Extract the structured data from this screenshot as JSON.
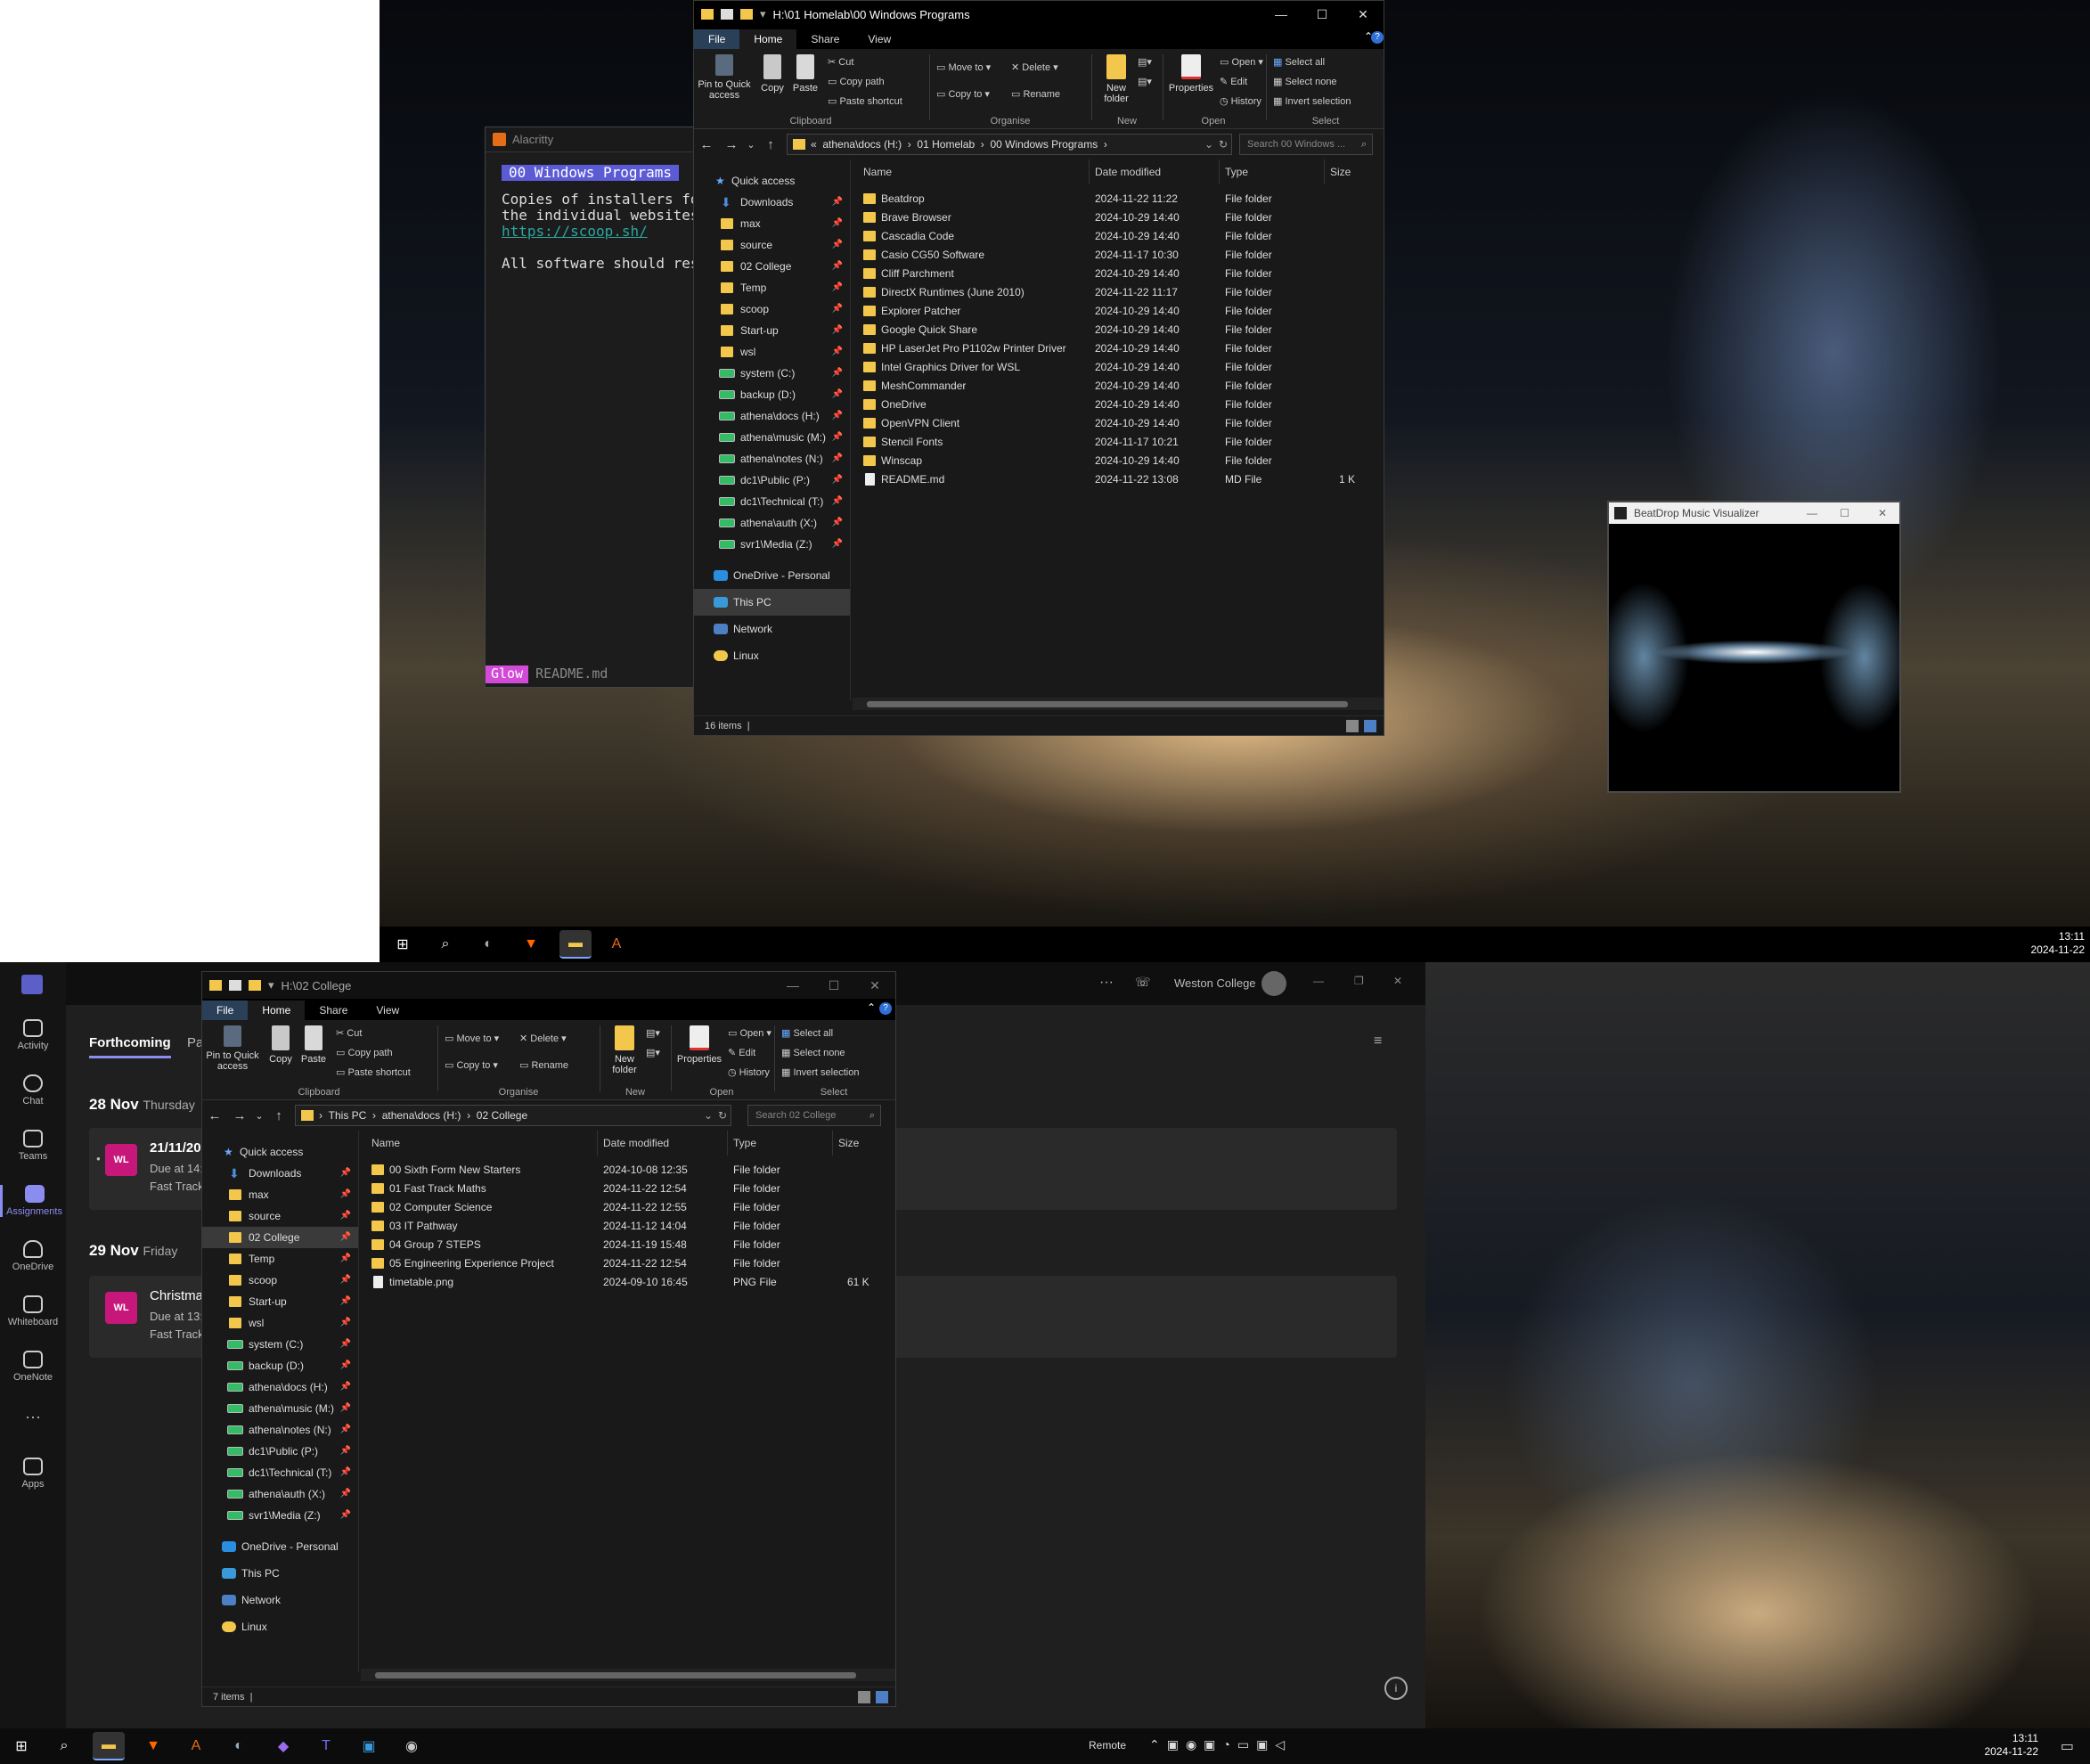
{
  "top_explorer": {
    "title": "H:\\01 Homelab\\00 Windows Programs",
    "tabs": [
      "File",
      "Home",
      "Share",
      "View"
    ],
    "ribbon": {
      "clipboard": {
        "pin": "Pin to Quick access",
        "copy": "Copy",
        "paste": "Paste",
        "cut": "Cut",
        "copy_path": "Copy path",
        "paste_shortcut": "Paste shortcut",
        "label": "Clipboard"
      },
      "organise": {
        "move_to": "Move to",
        "copy_to": "Copy to",
        "delete": "Delete",
        "rename": "Rename",
        "label": "Organise"
      },
      "new": {
        "new_folder": "New folder",
        "label": "New"
      },
      "open": {
        "properties": "Properties",
        "open": "Open",
        "edit": "Edit",
        "history": "History",
        "label": "Open"
      },
      "select": {
        "select_all": "Select all",
        "select_none": "Select none",
        "invert": "Invert selection",
        "label": "Select"
      }
    },
    "breadcrumb": [
      "«",
      "athena\\docs (H:)",
      "01 Homelab",
      "00 Windows Programs"
    ],
    "search_placeholder": "Search 00 Windows ...",
    "columns": [
      "Name",
      "Date modified",
      "Type",
      "Size"
    ],
    "files": [
      {
        "name": "Beatdrop",
        "date": "2024-11-22 11:22",
        "type": "File folder",
        "size": ""
      },
      {
        "name": "Brave Browser",
        "date": "2024-10-29 14:40",
        "type": "File folder",
        "size": ""
      },
      {
        "name": "Cascadia Code",
        "date": "2024-10-29 14:40",
        "type": "File folder",
        "size": ""
      },
      {
        "name": "Casio CG50 Software",
        "date": "2024-11-17 10:30",
        "type": "File folder",
        "size": ""
      },
      {
        "name": "Cliff Parchment",
        "date": "2024-10-29 14:40",
        "type": "File folder",
        "size": ""
      },
      {
        "name": "DirectX Runtimes (June 2010)",
        "date": "2024-11-22 11:17",
        "type": "File folder",
        "size": ""
      },
      {
        "name": "Explorer Patcher",
        "date": "2024-10-29 14:40",
        "type": "File folder",
        "size": ""
      },
      {
        "name": "Google Quick Share",
        "date": "2024-10-29 14:40",
        "type": "File folder",
        "size": ""
      },
      {
        "name": "HP LaserJet Pro P1102w Printer Driver",
        "date": "2024-10-29 14:40",
        "type": "File folder",
        "size": ""
      },
      {
        "name": "Intel Graphics Driver for WSL",
        "date": "2024-10-29 14:40",
        "type": "File folder",
        "size": ""
      },
      {
        "name": "MeshCommander",
        "date": "2024-10-29 14:40",
        "type": "File folder",
        "size": ""
      },
      {
        "name": "OneDrive",
        "date": "2024-10-29 14:40",
        "type": "File folder",
        "size": ""
      },
      {
        "name": "OpenVPN Client",
        "date": "2024-10-29 14:40",
        "type": "File folder",
        "size": ""
      },
      {
        "name": "Stencil Fonts",
        "date": "2024-11-17 10:21",
        "type": "File folder",
        "size": ""
      },
      {
        "name": "Winscap",
        "date": "2024-10-29 14:40",
        "type": "File folder",
        "size": ""
      },
      {
        "name": "README.md",
        "date": "2024-11-22 13:08",
        "type": "MD File",
        "size": "1 K"
      }
    ],
    "status": "16 items"
  },
  "nav_pane": {
    "quick_access": "Quick access",
    "items": [
      "Downloads",
      "max",
      "source",
      "02 College",
      "Temp",
      "scoop",
      "Start-up",
      "wsl",
      "system (C:)",
      "backup (D:)",
      "athena\\docs (H:)",
      "athena\\music (M:)",
      "athena\\notes (N:)",
      "dc1\\Public (P:)",
      "dc1\\Technical (T:)",
      "athena\\auth (X:)",
      "svr1\\Media (Z:)"
    ],
    "onedrive": "OneDrive - Personal",
    "this_pc": "This PC",
    "network": "Network",
    "linux": "Linux"
  },
  "bottom_explorer": {
    "title": "H:\\02 College",
    "breadcrumb": [
      "This PC",
      "athena\\docs (H:)",
      "02 College"
    ],
    "search_placeholder": "Search 02 College",
    "files": [
      {
        "name": "00 Sixth Form New Starters",
        "date": "2024-10-08 12:35",
        "type": "File folder",
        "size": ""
      },
      {
        "name": "01 Fast Track Maths",
        "date": "2024-11-22 12:54",
        "type": "File folder",
        "size": ""
      },
      {
        "name": "02 Computer Science",
        "date": "2024-11-22 12:55",
        "type": "File folder",
        "size": ""
      },
      {
        "name": "03 IT Pathway",
        "date": "2024-11-12 14:04",
        "type": "File folder",
        "size": ""
      },
      {
        "name": "04 Group 7 STEPS",
        "date": "2024-11-19 15:48",
        "type": "File folder",
        "size": ""
      },
      {
        "name": "05 Engineering Experience Project",
        "date": "2024-11-22 12:54",
        "type": "File folder",
        "size": ""
      },
      {
        "name": "timetable.png",
        "date": "2024-09-10 16:45",
        "type": "PNG File",
        "size": "61 K"
      }
    ],
    "status": "7 items"
  },
  "alacritty": {
    "title": "Alacritty",
    "heading": "00 Windows Programs",
    "line1": "Copies of installers for",
    "line2": "the individual websites",
    "link": "https://scoop.sh/",
    "line3": "All software should resi",
    "glow": "Glow",
    "file": "README.md"
  },
  "beatdrop": {
    "title": "BeatDrop Music Visualizer"
  },
  "teams": {
    "rail": [
      "Activity",
      "Chat",
      "Teams",
      "Assignments",
      "OneDrive",
      "Whiteboard",
      "OneNote",
      "Apps"
    ],
    "tabs": [
      "Forthcoming",
      "Pa"
    ],
    "org": "Weston College",
    "groups": [
      {
        "date": "28 Nov",
        "day": "Thursday",
        "title": "21/11/202",
        "due": "Due at 14:",
        "class": "Fast Track",
        "avatar": "WL"
      },
      {
        "date": "29 Nov",
        "day": "Friday",
        "title": "Christma",
        "due": "Due at 13:",
        "class": "Fast Track",
        "avatar": "WL"
      }
    ]
  },
  "taskbar_top": {
    "time": "13:11",
    "date": "2024-11-22"
  },
  "taskbar_bottom": {
    "remote": "Remote",
    "time": "13:11",
    "date": "2024-11-22"
  },
  "colors": {
    "folder": "#f3c74b",
    "accent": "#7aa7ff",
    "teams_accent": "#8b8cf0",
    "avatar": "#c8177b"
  }
}
